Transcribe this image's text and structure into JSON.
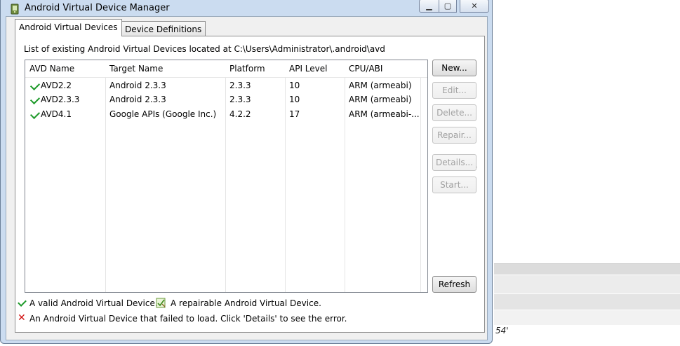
{
  "window": {
    "title": "Android Virtual Device Manager"
  },
  "tabs": [
    {
      "label": "Android Virtual Devices",
      "active": true
    },
    {
      "label": "Device Definitions",
      "active": false
    }
  ],
  "panel": {
    "location_label": "List of existing Android Virtual Devices located at C:\\Users\\Administrator\\.android\\avd"
  },
  "table": {
    "columns": [
      "AVD Name",
      "Target Name",
      "Platform",
      "API Level",
      "CPU/ABI"
    ],
    "rows": [
      {
        "name": "AVD2.2",
        "target": "Android 2.3.3",
        "platform": "2.3.3",
        "api": "10",
        "abi": "ARM (armeabi)"
      },
      {
        "name": "AVD2.3.3",
        "target": "Android 2.3.3",
        "platform": "2.3.3",
        "api": "10",
        "abi": "ARM (armeabi)"
      },
      {
        "name": "AVD4.1",
        "target": "Google APIs (Google Inc.)",
        "platform": "4.2.2",
        "api": "17",
        "abi": "ARM (armeabi-..."
      }
    ]
  },
  "buttons": {
    "new": "New...",
    "edit": "Edit...",
    "delete": "Delete...",
    "repair": "Repair...",
    "details": "Details...",
    "start": "Start...",
    "refresh": "Refresh"
  },
  "legend": {
    "valid": "A valid Android Virtual Device.",
    "repairable": "A repairable Android Virtual Device.",
    "failed": "An Android Virtual Device that failed to load. Click 'Details' to see the error."
  },
  "background": {
    "fragment_text": "54'"
  },
  "colors": {
    "valid_check": "#1e9a2a",
    "error_x": "#d01010",
    "title_bar": "#cbdcf0"
  }
}
